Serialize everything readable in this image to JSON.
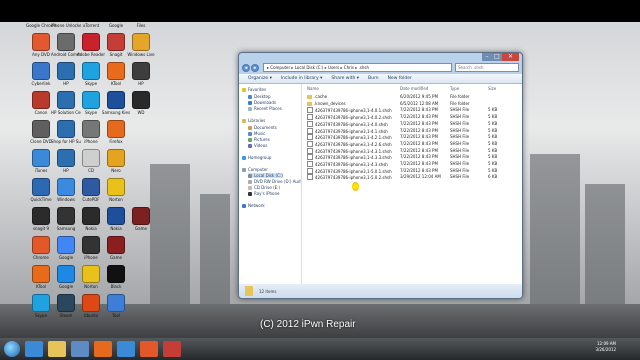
{
  "watermark": "(C) 2012 iPwn Repair",
  "desktop": {
    "icons": [
      {
        "label": "Google Chrome",
        "color": "#4a8fe7"
      },
      {
        "label": "iPhone Unlocker",
        "color": "#c9c9c9"
      },
      {
        "label": "uTorrent",
        "color": "#5aa33c"
      },
      {
        "label": "Google",
        "color": "#d03a2c"
      },
      {
        "label": "Files",
        "color": "#f2f2f2"
      },
      {
        "label": "Any DVD",
        "color": "#e2582f"
      },
      {
        "label": "Android Commander",
        "color": "#6b6b6b"
      },
      {
        "label": "Adobe Reader",
        "color": "#c8232c"
      },
      {
        "label": "Snagit",
        "color": "#c43d37"
      },
      {
        "label": "Windows Live",
        "color": "#e3a62b"
      },
      {
        "label": "Cyberlink",
        "color": "#3a77c8"
      },
      {
        "label": "HP",
        "color": "#2c6fb1"
      },
      {
        "label": "Skype",
        "color": "#1ea3e0"
      },
      {
        "label": "KTool",
        "color": "#e76b1b"
      },
      {
        "label": "HP",
        "color": "#3e3e3e"
      },
      {
        "label": "Canon",
        "color": "#b93a2c"
      },
      {
        "label": "HP Solution Center",
        "color": "#2c6fb1"
      },
      {
        "label": "Skype",
        "color": "#1ea3e0"
      },
      {
        "label": "Samsung Kies",
        "color": "#1e4f9a"
      },
      {
        "label": "WD",
        "color": "#2a2a2a"
      },
      {
        "label": "Clone DVD",
        "color": "#5f5f5f"
      },
      {
        "label": "Shop for HP Supplies",
        "color": "#2c6fb1"
      },
      {
        "label": "iPhone",
        "color": "#777"
      },
      {
        "label": "Firefox",
        "color": "#e66a1e"
      },
      {
        "label": "iTunes",
        "color": "#3b8ad8"
      },
      {
        "label": "HP",
        "color": "#2c6fb1"
      },
      {
        "label": "CD",
        "color": "#cfcfcf"
      },
      {
        "label": "Nero",
        "color": "#e5a41f"
      },
      {
        "label": "QuickTime",
        "color": "#2b6ab3"
      },
      {
        "label": "Windows",
        "color": "#3a8be0"
      },
      {
        "label": "CutePDF",
        "color": "#2d5aa0"
      },
      {
        "label": "Norton",
        "color": "#e8c21a"
      },
      {
        "label": "snagit 9",
        "color": "#2b2b2b"
      },
      {
        "label": "Samsung",
        "color": "#333"
      },
      {
        "label": "Nokia",
        "color": "#2b2b2b"
      },
      {
        "label": "Nokia",
        "color": "#1e4f9a"
      },
      {
        "label": "Game",
        "color": "#7b2121"
      },
      {
        "label": "Chrome",
        "color": "#e35829"
      },
      {
        "label": "Google",
        "color": "#4285f4"
      },
      {
        "label": "iPhone",
        "color": "#333"
      },
      {
        "label": "Game",
        "color": "#8a1f1f"
      },
      {
        "label": "KTool",
        "color": "#e76b1b"
      },
      {
        "label": "Google",
        "color": "#1e88e5"
      },
      {
        "label": "Norton",
        "color": "#e8c21a"
      },
      {
        "label": "Black",
        "color": "#111"
      },
      {
        "label": "Skype",
        "color": "#1ea3e0"
      },
      {
        "label": "Steam",
        "color": "#2a475e"
      },
      {
        "label": "Ubuntu",
        "color": "#dd4814"
      },
      {
        "label": "Tool",
        "color": "#3e7ed8"
      }
    ]
  },
  "explorer": {
    "breadcrumb": "▸ Computer ▸ Local Disk (C:) ▸ Users ▸ Chris ▸ .shsh",
    "search_placeholder": "Search .shsh",
    "toolbar": {
      "organize": "Organize ▾",
      "include": "Include in library ▾",
      "share": "Share with ▾",
      "burn": "Burn",
      "new_folder": "New folder"
    },
    "nav": {
      "favorites": "Favorites",
      "desktop": "Desktop",
      "downloads": "Downloads",
      "recent": "Recent Places",
      "libraries": "Libraries",
      "documents": "Documents",
      "music": "Music",
      "pictures": "Pictures",
      "videos": "Videos",
      "homegroup": "Homegroup",
      "computer": "Computer",
      "local_disk": "Local Disk (C:)",
      "dvd": "DVD RW Drive (D:) Aud",
      "cd": "CD Drive (E:)",
      "phone": "Ray's iPhone",
      "network": "Network"
    },
    "columns": {
      "name": "Name",
      "date": "Date modified",
      "type": "Type",
      "size": "Size"
    },
    "files": [
      {
        "name": ".cache",
        "date": "6/20/2012 9:45 PM",
        "type": "File folder",
        "size": "",
        "folder": true
      },
      {
        "name": ".known_devices",
        "date": "6/5/2012 12:08 AM",
        "type": "File folder",
        "size": "",
        "folder": true
      },
      {
        "name": "4263797439786-iphone3,1-4.0.1.shsh",
        "date": "7/22/2012 8:43 PM",
        "type": "SHSH File",
        "size": "5 KB"
      },
      {
        "name": "4263797439786-iphone3,1-4.0.2.shsh",
        "date": "7/22/2012 8:43 PM",
        "type": "SHSH File",
        "size": "5 KB"
      },
      {
        "name": "4263797439786-iphone3,1-4.0.shsh",
        "date": "7/22/2012 8:43 PM",
        "type": "SHSH File",
        "size": "5 KB"
      },
      {
        "name": "4263797439786-iphone3,1-4.1.shsh",
        "date": "7/22/2012 8:43 PM",
        "type": "SHSH File",
        "size": "5 KB"
      },
      {
        "name": "4263797439786-iphone3,1-4.2.1.shsh",
        "date": "7/22/2012 8:43 PM",
        "type": "SHSH File",
        "size": "5 KB"
      },
      {
        "name": "4263797439786-iphone3,1-4.2.6.shsh",
        "date": "7/22/2012 8:43 PM",
        "type": "SHSH File",
        "size": "5 KB"
      },
      {
        "name": "4263797439786-iphone3,1-4.3.1.shsh",
        "date": "7/22/2012 8:43 PM",
        "type": "SHSH File",
        "size": "5 KB"
      },
      {
        "name": "4263797439786-iphone3,1-4.3.3.shsh",
        "date": "7/22/2012 8:43 PM",
        "type": "SHSH File",
        "size": "5 KB"
      },
      {
        "name": "4263797439786-iphone3,1-4.3.shsh",
        "date": "7/22/2012 8:43 PM",
        "type": "SHSH File",
        "size": "5 KB"
      },
      {
        "name": "4263797439786-iphone3,1-5.0.1.shsh",
        "date": "7/22/2012 8:43 PM",
        "type": "SHSH File",
        "size": "5 KB"
      },
      {
        "name": "4263797439786-iphone3,1-5.0.2.shsh",
        "date": "3/29/2012 12:04 AM",
        "type": "SHSH File",
        "size": "6 KB"
      }
    ],
    "status": "12 items"
  },
  "clock": {
    "time": "12:09 AM",
    "date": "3/26/2012"
  }
}
